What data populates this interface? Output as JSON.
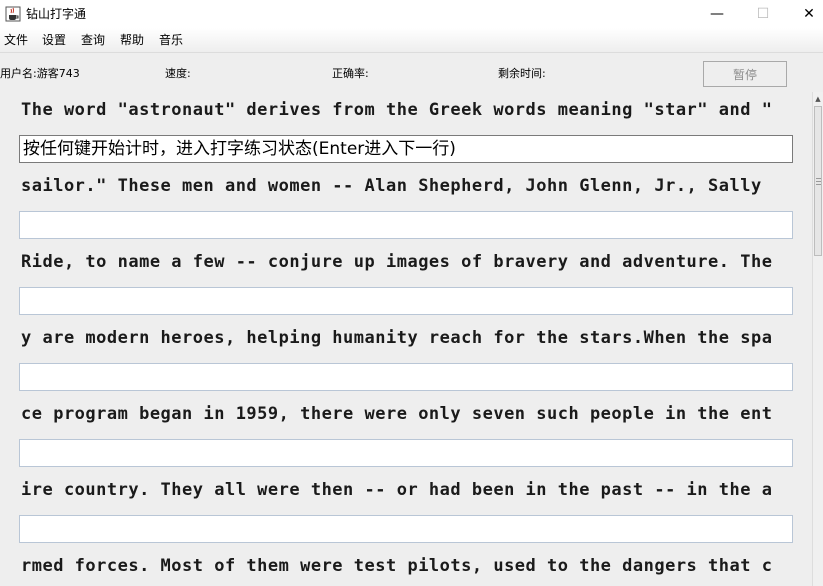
{
  "window": {
    "title": "钻山打字通",
    "icon": "java-cup-icon",
    "controls": {
      "minimize": "—",
      "maximize": "☐",
      "close": "✕"
    }
  },
  "menu": [
    "文件",
    "设置",
    "查询",
    "帮助",
    "音乐"
  ],
  "status": {
    "user": "用户名:游客743",
    "speed": "速度:",
    "accuracy": "正确率:",
    "remaining": "剩余时间:",
    "pause_label": "暂停"
  },
  "practice": {
    "lines": [
      "The word \"astronaut\" derives from the Greek words meaning \"star\" and \"",
      "sailor.\" These men and women -- Alan Shepherd, John Glenn, Jr., Sally",
      "Ride, to name a few -- conjure up images of bravery and adventure. The",
      "y are modern heroes, helping humanity reach for the stars.When the spa",
      "ce program began in 1959, there were only seven such people in the ent",
      "ire country. They all were then -- or had been in the past -- in the a",
      "rmed forces. Most of them were test pilots, used to the dangers that c"
    ],
    "inputs": [
      "按任何键开始计时，进入打字练习状态(Enter进入下一行)",
      "",
      "",
      "",
      "",
      "",
      ""
    ]
  }
}
